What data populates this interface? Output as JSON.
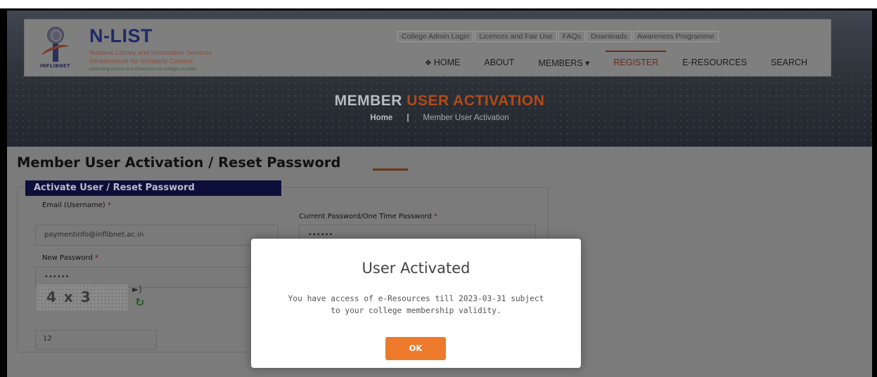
{
  "header": {
    "brand_name": "N-LIST",
    "brand_sub1": "National Library and Information Services",
    "brand_sub2": "Infrastructure for Scholarly Content",
    "brand_tagline": "extending access to e-Resources to colleges in India",
    "logo_text": "INFLIBNET",
    "top_links": [
      "College Admin Login",
      "Licences and Fair Use",
      "FAQs",
      "Downloads",
      "Awareness Programme"
    ],
    "nav": [
      {
        "label": "HOME",
        "icon": "home-icon"
      },
      {
        "label": "ABOUT"
      },
      {
        "label": "MEMBERS ▾"
      },
      {
        "label": "REGISTER",
        "active": true
      },
      {
        "label": "E-RESOURCES"
      },
      {
        "label": "SEARCH"
      }
    ]
  },
  "hero": {
    "title_main": "MEMBER",
    "title_accent": "USER ACTIVATION",
    "crumb_home": "Home",
    "crumb_sep": "|",
    "crumb_current": "Member User Activation"
  },
  "form": {
    "section_title": "Member User Activation / Reset Password",
    "legend": "Activate User / Reset Password",
    "email_label": "Email (Username)",
    "email_value": "paymentinfo@inflibnet.ac.in",
    "current_password_label": "Current Password/One Time Password",
    "current_password_value": "••••••",
    "new_password_label": "New Password",
    "new_password_value": "••••••",
    "required_mark": "*",
    "captcha_text": "4 x 3",
    "captcha_answer": "12"
  },
  "modal": {
    "title": "User Activated",
    "message_line1": "You have access of e-Resources till 2023-03-31 subject",
    "message_line2": "to your college membership validity.",
    "ok_label": "OK"
  },
  "colors": {
    "modal_button": "#ec7a2a",
    "legend_bg": "#0c0f3a",
    "accent": "#b44a18"
  }
}
